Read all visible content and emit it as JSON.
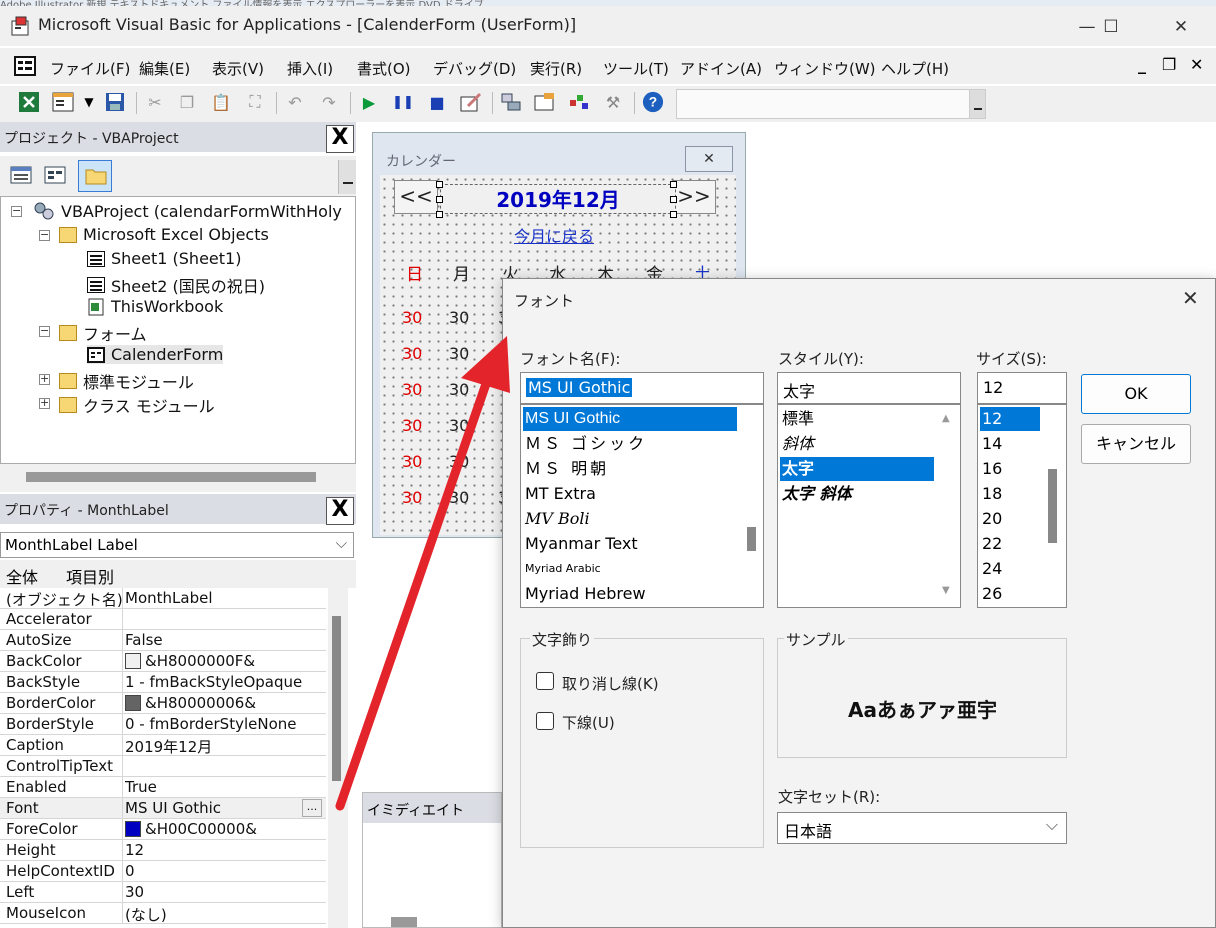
{
  "window": {
    "background_text": "Adobe Illustrator  新規 テキストドキュメント   ファイル情報を表示   エクスプローラーを表示   DVD ドライブ",
    "title": "Microsoft Visual Basic for Applications - [CalenderForm (UserForm)]",
    "minimize": "—",
    "maximize": "☐",
    "close": "✕"
  },
  "menubar": {
    "items": [
      {
        "label": "ファイル(F)",
        "underline": "F"
      },
      {
        "label": "編集(E)"
      },
      {
        "label": "表示(V)"
      },
      {
        "label": "挿入(I)"
      },
      {
        "label": "書式(O)"
      },
      {
        "label": "デバッグ(D)"
      },
      {
        "label": "実行(R)"
      },
      {
        "label": "ツール(T)"
      },
      {
        "label": "アドイン(A)"
      },
      {
        "label": "ウィンドウ(W)"
      },
      {
        "label": "ヘルプ(H)"
      }
    ],
    "mdi_minimize": "_",
    "mdi_restore": "❐",
    "mdi_close": "✕"
  },
  "toolbar": {
    "icons": [
      "excel-icon",
      "insert-userform-icon",
      "dropdown-icon",
      "save-icon",
      "cut-icon",
      "copy-icon",
      "paste-icon",
      "find-icon",
      "undo-icon",
      "redo-icon",
      "run-icon",
      "break-icon",
      "reset-icon",
      "design-mode-icon",
      "project-explorer-icon",
      "properties-icon",
      "object-browser-icon",
      "toolbox-icon",
      "help-icon"
    ]
  },
  "project": {
    "title": "プロジェクト - VBAProject",
    "close": "X",
    "tree": [
      {
        "label": "VBAProject (calendarFormWithHoly"
      },
      {
        "label": "Microsoft Excel Objects"
      },
      {
        "label": "Sheet1 (Sheet1)"
      },
      {
        "label": "Sheet2 (国民の祝日)"
      },
      {
        "label": "ThisWorkbook"
      },
      {
        "label": "フォーム"
      },
      {
        "label": "CalenderForm"
      },
      {
        "label": "標準モジュール"
      },
      {
        "label": "クラス モジュール"
      }
    ]
  },
  "properties": {
    "title": "プロパティ - MonthLabel",
    "close": "X",
    "object_name": "MonthLabel",
    "object_type": "Label",
    "tabs": [
      "全体",
      "項目別"
    ],
    "rows": [
      {
        "key": "(オブジェクト名)",
        "value": "MonthLabel"
      },
      {
        "key": "Accelerator",
        "value": ""
      },
      {
        "key": "AutoSize",
        "value": "False"
      },
      {
        "key": "BackColor",
        "value": "&H8000000F&",
        "color": "#f0f0f0"
      },
      {
        "key": "BackStyle",
        "value": "1 - fmBackStyleOpaque"
      },
      {
        "key": "BorderColor",
        "value": "&H80000006&",
        "color": "#646464"
      },
      {
        "key": "BorderStyle",
        "value": "0 - fmBorderStyleNone"
      },
      {
        "key": "Caption",
        "value": "2019年12月"
      },
      {
        "key": "ControlTipText",
        "value": ""
      },
      {
        "key": "Enabled",
        "value": "True"
      },
      {
        "key": "Font",
        "value": "MS UI Gothic",
        "ellipsis": "..."
      },
      {
        "key": "ForeColor",
        "value": "&H00C00000&",
        "color": "#0000c0"
      },
      {
        "key": "Height",
        "value": "12"
      },
      {
        "key": "HelpContextID",
        "value": "0"
      },
      {
        "key": "Left",
        "value": "30"
      },
      {
        "key": "MouseIcon",
        "value": "(なし)"
      }
    ]
  },
  "calendar_form": {
    "title": "カレンダー",
    "close": "✕",
    "prev": "<<",
    "next": ">>",
    "month": "2019年12月",
    "today_link": "今月に戻る",
    "weekdays": [
      "日",
      "月",
      "火",
      "水",
      "木",
      "金",
      "土"
    ],
    "weekday_colors": {
      "sun": "#e00000",
      "sat": "#1a33c8",
      "other": "#222"
    },
    "day_rows": [
      [
        "30",
        "30",
        "30"
      ],
      [
        "30",
        "30"
      ],
      [
        "30",
        "30"
      ],
      [
        "30",
        "30"
      ],
      [
        "30",
        "30"
      ],
      [
        "30",
        "30",
        "30"
      ]
    ]
  },
  "immediate": {
    "title": "イミディエイト"
  },
  "font_dialog": {
    "title": "フォント",
    "close": "✕",
    "font_name_label": "フォント名(F):",
    "style_label": "スタイル(Y):",
    "size_label": "サイズ(S):",
    "font_name_value": "MS UI Gothic",
    "style_value": "太字",
    "size_value": "12",
    "fonts": [
      "MS UI Gothic",
      "ＭＳ ゴシック",
      "ＭＳ 明朝",
      "MT Extra",
      "MV Boli",
      "Myanmar Text",
      "Myriad Arabic",
      "Myriad Hebrew"
    ],
    "styles": [
      "標準",
      "斜体",
      "太字",
      "太字 斜体"
    ],
    "sizes": [
      "12",
      "14",
      "16",
      "18",
      "20",
      "22",
      "24",
      "26"
    ],
    "ok": "OK",
    "cancel": "キャンセル",
    "effects_label": "文字飾り",
    "strikeout_label": "取り消し線(K)",
    "underline_label": "下線(U)",
    "sample_label": "サンプル",
    "sample_text": "Aaあぁアァ亜宇",
    "charset_label": "文字セット(R):",
    "charset_value": "日本語"
  },
  "colors": {
    "selection": "#0078d7",
    "arrow": "#e3242b",
    "label_text": "#0000c0"
  }
}
